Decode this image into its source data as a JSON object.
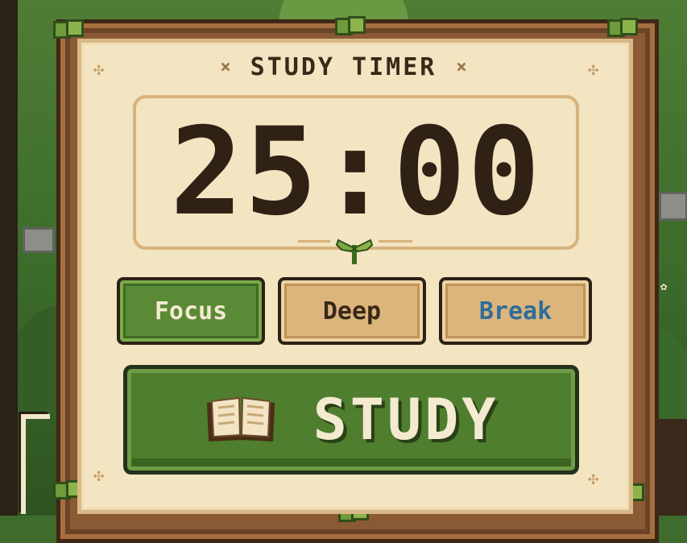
{
  "title": "STUDY TIMER",
  "title_ornament": "×",
  "timer": "25:00",
  "modes": [
    {
      "label": "Focus",
      "selected": true,
      "color": "#5a8a35"
    },
    {
      "label": "Deep",
      "selected": false,
      "color": "#dcb57d"
    },
    {
      "label": "Break",
      "selected": false,
      "color": "#dcb57d",
      "text_color": "#2f6d98"
    }
  ],
  "study_button": {
    "label": "STUDY",
    "icon": "open-book-icon"
  },
  "colors": {
    "panel": "#f3e4c2",
    "frame": "#8a5a34",
    "accent_green": "#4f7e2e",
    "text_dark": "#2f2114"
  }
}
